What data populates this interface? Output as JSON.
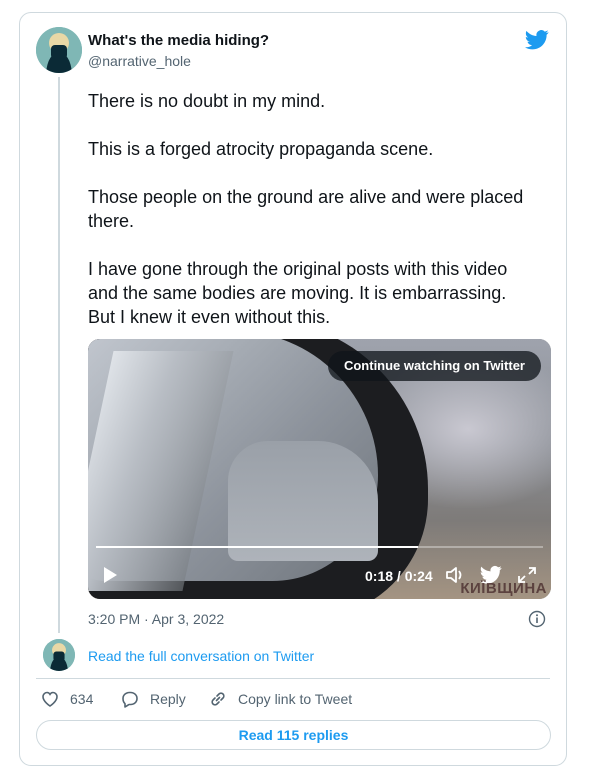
{
  "author": {
    "display_name": "What's the media hiding?",
    "handle": "@narrative_hole"
  },
  "tweet": {
    "paragraphs": [
      "There is no doubt in my mind.",
      "This is a forged atrocity propaganda scene.",
      "Those people on the ground are alive and were placed there.",
      "I have gone through the original posts with this video and the same bodies are moving. It is embarrassing. But I knew it even without this."
    ],
    "timestamp": "3:20 PM · Apr 3, 2022"
  },
  "video": {
    "overlay_button": "Continue watching on Twitter",
    "time_display": "0:18 / 0:24",
    "progress": 0.72,
    "watermark": "КИЇВЩИНА"
  },
  "conversation_link": "Read the full conversation on Twitter",
  "actions": {
    "likes_count": "634",
    "reply_label": "Reply",
    "copy_link_label": "Copy link to Tweet"
  },
  "read_replies_label": "Read 115 replies",
  "colors": {
    "accent": "#1d9bf0",
    "text": "#0f1419",
    "muted": "#536471",
    "border": "#cfd9de"
  },
  "icons": [
    "twitter-bird-icon",
    "play-icon",
    "volume-icon",
    "fullscreen-icon",
    "info-icon",
    "heart-icon",
    "reply-icon",
    "link-icon"
  ]
}
